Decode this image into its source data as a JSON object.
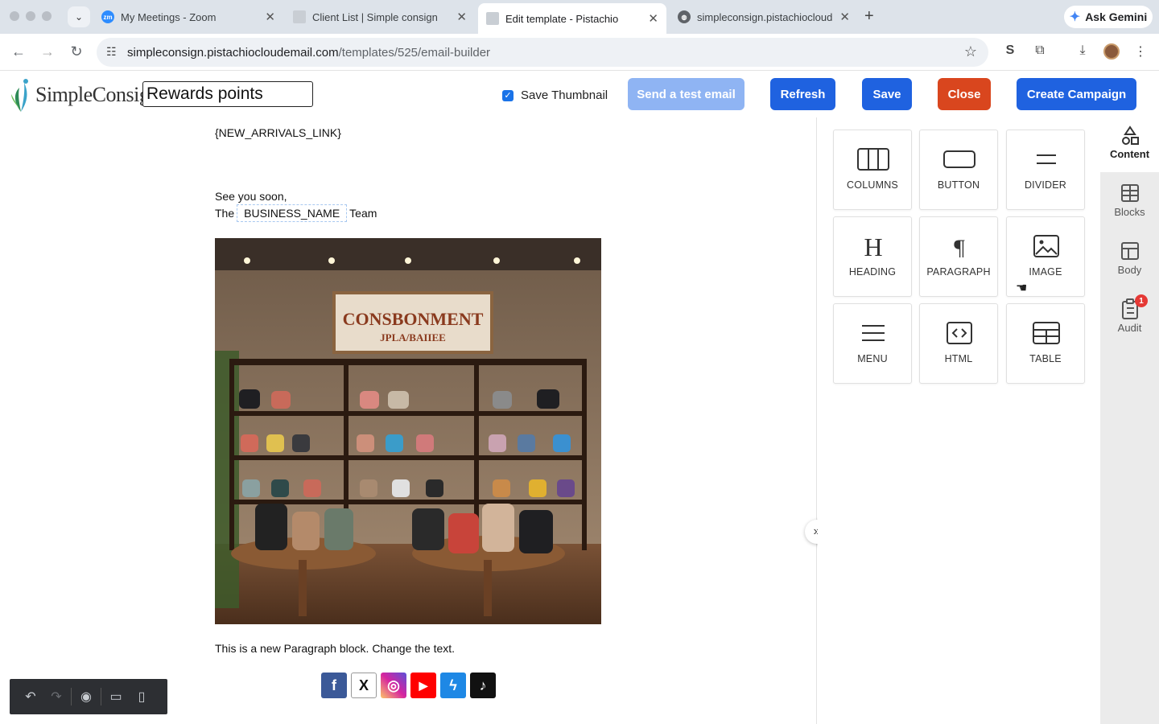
{
  "browser": {
    "tabs": [
      {
        "title": "My Meetings - Zoom",
        "favicon": "zoom-icon"
      },
      {
        "title": "Client List | Simple consign",
        "favicon": "pistachio-icon"
      },
      {
        "title": "Edit template - Pistachio",
        "favicon": "pistachio-icon"
      },
      {
        "title": "simpleconsign.pistachiocloud",
        "favicon": "globe-icon"
      }
    ],
    "gemini_label": "Ask Gemini",
    "url_host": "simpleconsign.pistachiocloudemail.com",
    "url_path": "/templates/525/email-builder"
  },
  "header": {
    "logo_text": "SimpleConsign",
    "template_name": "Rewards points",
    "save_thumbnail_label": "Save Thumbnail",
    "save_thumbnail_checked": true,
    "buttons": {
      "test_email": "Send a test email",
      "refresh": "Refresh",
      "save": "Save",
      "close": "Close",
      "create_campaign": "Create Campaign"
    },
    "colors": {
      "primary": "#1f62e0",
      "disabled": "#8fb4f3",
      "danger": "#d9461e"
    }
  },
  "email": {
    "arrivals_link": "{NEW_ARRIVALS_LINK}",
    "see_you": "See you soon,",
    "the": "The",
    "business_name": "BUSINESS_NAME",
    "team": "Team",
    "image_sign_line1": "CONSBONMENT",
    "image_sign_line2": "JPLA/BAIIEE",
    "paragraph": "This is a new Paragraph block. Change the text.",
    "socials": [
      {
        "name": "facebook",
        "glyph": "f",
        "color": "#3b5998"
      },
      {
        "name": "x",
        "glyph": "X",
        "color": "#ffffff"
      },
      {
        "name": "instagram",
        "glyph": "◎",
        "color": "#d6249f"
      },
      {
        "name": "youtube",
        "glyph": "▶",
        "color": "#ff0000"
      },
      {
        "name": "messenger",
        "glyph": "ϟ",
        "color": "#1e88e5"
      },
      {
        "name": "tiktok",
        "glyph": "♪",
        "color": "#111111"
      }
    ]
  },
  "tools": {
    "columns": "COLUMNS",
    "button": "BUTTON",
    "divider": "DIVIDER",
    "heading": "HEADING",
    "paragraph": "PARAGRAPH",
    "image": "IMAGE",
    "menu": "MENU",
    "html": "HTML",
    "table": "TABLE"
  },
  "sidebar": {
    "content": "Content",
    "blocks": "Blocks",
    "body": "Body",
    "audit": "Audit",
    "audit_badge": "1"
  }
}
